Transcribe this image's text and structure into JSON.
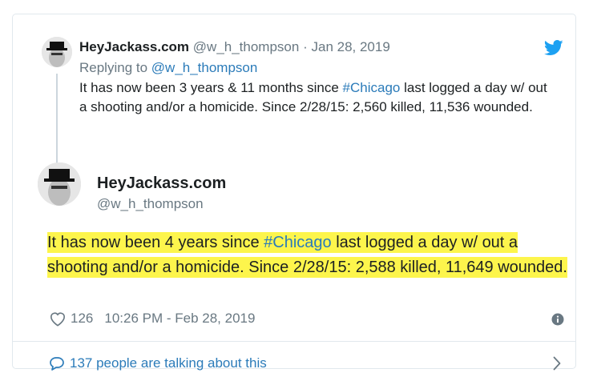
{
  "parent_tweet": {
    "name": "HeyJackass.com",
    "handle": "@w_h_thompson",
    "separator": "·",
    "date": "Jan 28, 2019",
    "replying_prefix": "Replying to ",
    "replying_handle": "@w_h_thompson",
    "text_before": "It has now been 3 years & 11 months since ",
    "hashtag": "#Chicago",
    "text_after": " last logged a day w/ out a shooting and/or a homicide. Since 2/28/15: 2,560 killed, 11,536 wounded."
  },
  "main_tweet": {
    "name": "HeyJackass.com",
    "handle": "@w_h_thompson",
    "text_before": "It has now been 4 years since ",
    "hashtag": "#Chicago",
    "text_after": " last logged a day w/ out a shooting and/or a homicide. Since 2/28/15: 2,588 killed, 11,649 wounded.",
    "likes": "126",
    "timestamp": "10:26 PM - Feb 28, 2019"
  },
  "footer": {
    "talking": "137 people are talking about this"
  },
  "icons": {
    "twitter": "twitter-bird-icon",
    "heart": "heart-icon",
    "info": "info-icon",
    "comment": "comment-bubble-icon",
    "chevron": "chevron-right-icon"
  },
  "colors": {
    "link": "#2b7bb9",
    "muted": "#697882",
    "highlight": "#fdf54c",
    "twitter_blue": "#1da1f2"
  }
}
